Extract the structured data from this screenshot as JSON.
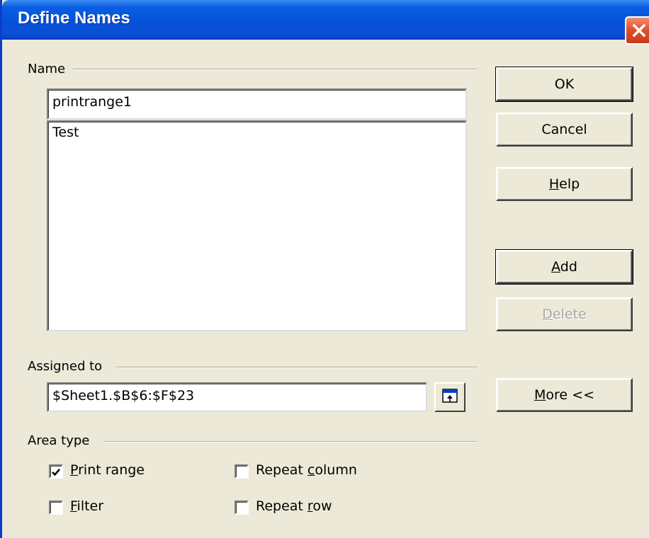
{
  "window": {
    "title": "Define Names"
  },
  "name_section": {
    "label": "Name",
    "input_value": "printrange1",
    "list_items": [
      "Test"
    ]
  },
  "assigned_section": {
    "label": "Assigned to",
    "input_value": "$Sheet1.$B$6:$F$23"
  },
  "area_type": {
    "label": "Area type",
    "options": [
      {
        "prefix": "",
        "key": "P",
        "rest": "rint range",
        "checked": true
      },
      {
        "prefix": "",
        "key": "F",
        "rest": "ilter",
        "checked": false
      },
      {
        "prefix": "Repeat ",
        "key": "c",
        "rest": "olumn",
        "checked": false
      },
      {
        "prefix": "Repeat ",
        "key": "r",
        "rest": "ow",
        "checked": false
      }
    ]
  },
  "buttons": {
    "ok": "OK",
    "cancel": "Cancel",
    "help_key": "H",
    "help_rest": "elp",
    "add_key": "A",
    "add_rest": "dd",
    "delete_key": "D",
    "delete_rest": "elete",
    "more_key": "M",
    "more_rest": "ore <<"
  },
  "colors": {
    "titlebar": "#0651d9",
    "dialog_bg": "#ece9d8",
    "close_button": "#e2512c"
  }
}
